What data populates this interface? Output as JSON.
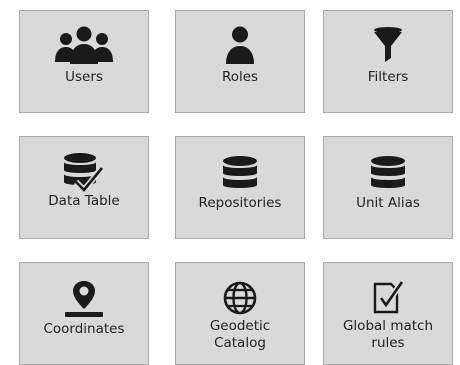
{
  "tiles": [
    {
      "label": "Users",
      "icon": "users-icon"
    },
    {
      "label": "Roles",
      "icon": "user-icon"
    },
    {
      "label": "Filters",
      "icon": "funnel-icon"
    },
    {
      "label": "Data Table",
      "icon": "database-check-icon"
    },
    {
      "label": "Repositories",
      "icon": "database-icon"
    },
    {
      "label": "Unit Alias",
      "icon": "database-icon"
    },
    {
      "label": "Coordinates",
      "icon": "map-pin-icon"
    },
    {
      "label": "Geodetic\nCatalog",
      "icon": "globe-icon"
    },
    {
      "label": "Global match\nrules",
      "icon": "document-check-icon"
    }
  ],
  "colors": {
    "tile_background": "#d9d9d9",
    "tile_border": "#a9a9a9",
    "icon": "#1a1a1a"
  }
}
